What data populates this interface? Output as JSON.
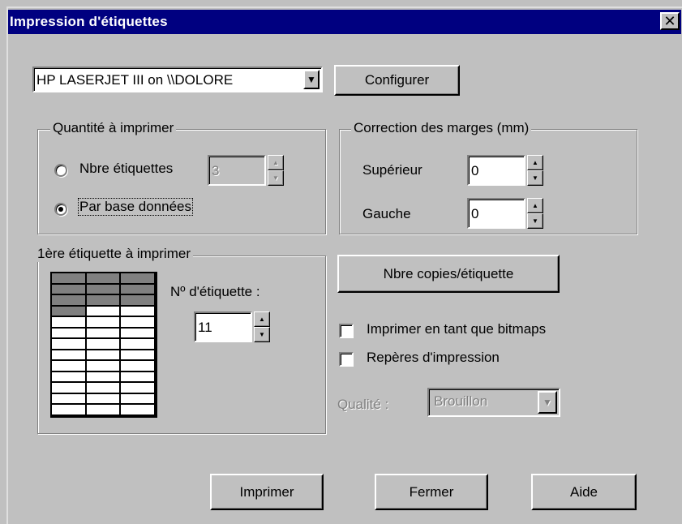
{
  "window": {
    "title": "Impression d'étiquettes",
    "close_symbol": "✕"
  },
  "printer": {
    "selected": "HP LASERJET III on \\\\DOLORE",
    "configure_label": "Configurer"
  },
  "quantity": {
    "group_label": "Quantité à imprimer",
    "option_count_label": "Nbre étiquettes",
    "option_count_value": "3",
    "option_count_checked": false,
    "option_db_label": "Par base données",
    "option_db_checked": true
  },
  "margins": {
    "group_label": "Correction des marges (mm)",
    "top_label": "Supérieur",
    "top_value": "0",
    "left_label": "Gauche",
    "left_value": "0"
  },
  "first_label": {
    "group_label": "1ère étiquette à imprimer",
    "number_label": "Nº d'étiquette :",
    "number_value": "11",
    "grid_rows": 13,
    "grid_cols": 3,
    "printed_cells": 10
  },
  "copies_button_label": "Nbre copies/étiquette",
  "options": {
    "bitmaps_label": "Imprimer en tant que bitmaps",
    "bitmaps_checked": false,
    "marks_label": "Repères d'impression",
    "marks_checked": false
  },
  "quality": {
    "label": "Qualité :",
    "selected": "Brouillon"
  },
  "buttons": {
    "print_label": "Imprimer",
    "close_label": "Fermer",
    "help_label": "Aide"
  },
  "colors": {
    "titlebar": "#000080",
    "face": "#c0c0c0"
  },
  "icons": {
    "close": "close-icon",
    "spin_up": "spin-up-arrow-icon",
    "spin_down": "spin-down-arrow-icon",
    "dropdown": "dropdown-arrow-icon"
  }
}
